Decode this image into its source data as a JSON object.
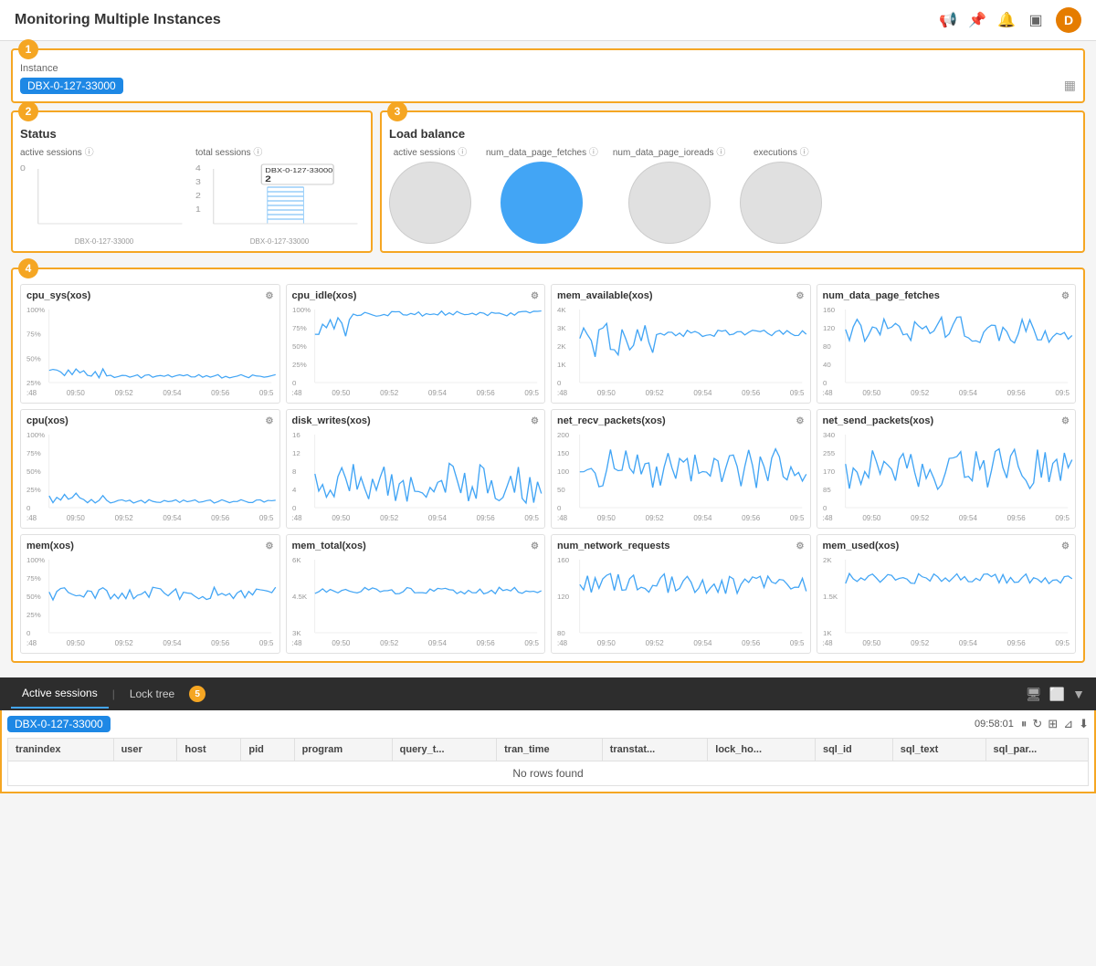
{
  "header": {
    "title": "Monitoring Multiple Instances",
    "avatar": "D"
  },
  "section1": {
    "badge": "1",
    "label": "Instance",
    "tag": "DBX-0-127-33000"
  },
  "section2": {
    "badge": "2",
    "title": "Status",
    "chart1_label": "active sessions",
    "chart2_label": "total sessions",
    "chart2_tooltip": "DBX-0-127-33000",
    "chart2_value": "2",
    "x_label1": "DBX-0-127-33000",
    "x_label2": "DBX-0-127-33000",
    "y_max1": "0",
    "y_max2": "4"
  },
  "section3": {
    "badge": "3",
    "title": "Load balance",
    "bubbles": [
      {
        "label": "active sessions",
        "size": 90,
        "filled": false
      },
      {
        "label": "num_data_page_fetches",
        "size": 90,
        "filled": true
      },
      {
        "label": "num_data_page_ioreads",
        "size": 90,
        "filled": false
      },
      {
        "label": "executions",
        "size": 90,
        "filled": false
      }
    ]
  },
  "section4": {
    "badge": "4",
    "metrics": [
      {
        "id": "cpu_sys",
        "title": "cpu_sys(xos)",
        "y_labels": [
          "100%",
          "75%",
          "50%",
          "25%"
        ],
        "x_labels": [
          ":48",
          "09:50",
          "09:52",
          "09:54",
          "09:56",
          "09:5"
        ]
      },
      {
        "id": "cpu_idle",
        "title": "cpu_idle(xos)",
        "y_labels": [
          "100%",
          "75%",
          "50%",
          "25%",
          "0"
        ],
        "x_labels": [
          ":48",
          "09:50",
          "09:52",
          "09:54",
          "09:56",
          "09:5"
        ]
      },
      {
        "id": "mem_available",
        "title": "mem_available(xos)",
        "y_labels": [
          "4K",
          "3K",
          "2K",
          "1K",
          "0"
        ],
        "x_labels": [
          ":48",
          "09:50",
          "09:52",
          "09:54",
          "09:56",
          "09:5"
        ]
      },
      {
        "id": "num_data_page_fetches",
        "title": "num_data_page_fetches",
        "y_labels": [
          "160",
          "120",
          "80",
          "40",
          "0"
        ],
        "x_labels": [
          ":48",
          "09:50",
          "09:52",
          "09:54",
          "09:56",
          "09:5"
        ]
      },
      {
        "id": "cpu",
        "title": "cpu(xos)",
        "y_labels": [
          "100%",
          "75%",
          "50%",
          "25%",
          "0"
        ],
        "x_labels": [
          ":48",
          "09:50",
          "09:52",
          "09:54",
          "09:56",
          "09:5"
        ]
      },
      {
        "id": "disk_writes",
        "title": "disk_writes(xos)",
        "y_labels": [
          "16",
          "12",
          "8",
          "4",
          "0"
        ],
        "x_labels": [
          ":48",
          "09:50",
          "09:52",
          "09:54",
          "09:56",
          "09:5"
        ]
      },
      {
        "id": "net_recv_packets",
        "title": "net_recv_packets(xos)",
        "y_labels": [
          "200",
          "150",
          "100",
          "50",
          "0"
        ],
        "x_labels": [
          ":48",
          "09:50",
          "09:52",
          "09:54",
          "09:56",
          "09:5"
        ]
      },
      {
        "id": "net_send_packets",
        "title": "net_send_packets(xos)",
        "y_labels": [
          "340",
          "255",
          "170",
          "85",
          "0"
        ],
        "x_labels": [
          ":48",
          "09:50",
          "09:52",
          "09:54",
          "09:56",
          "09:5"
        ]
      },
      {
        "id": "mem",
        "title": "mem(xos)",
        "y_labels": [
          "100%",
          "75%",
          "50%",
          "25%",
          "0"
        ],
        "x_labels": [
          ":48",
          "09:50",
          "09:52",
          "09:54",
          "09:56",
          "09:5"
        ]
      },
      {
        "id": "mem_total",
        "title": "mem_total(xos)",
        "y_labels": [
          "6K",
          "4.5K",
          "3K"
        ],
        "x_labels": [
          ":48",
          "09:50",
          "09:52",
          "09:54",
          "09:56",
          "09:5"
        ]
      },
      {
        "id": "num_network_requests",
        "title": "num_network_requests",
        "y_labels": [
          "160",
          "120",
          "80"
        ],
        "x_labels": [
          ":48",
          "09:50",
          "09:52",
          "09:54",
          "09:56",
          "09:5"
        ]
      },
      {
        "id": "mem_used",
        "title": "mem_used(xos)",
        "y_labels": [
          "2K",
          "1.5K",
          "1K"
        ],
        "x_labels": [
          ":48",
          "09:50",
          "09:52",
          "09:54",
          "09:56",
          "09:5"
        ]
      }
    ]
  },
  "section5": {
    "badge": "5",
    "tabs": [
      {
        "label": "Active sessions",
        "active": true
      },
      {
        "label": "Lock tree",
        "active": false
      }
    ],
    "instance_tag": "DBX-0-127-33000",
    "timestamp": "09:58:01",
    "table": {
      "columns": [
        "tranindex",
        "user",
        "host",
        "pid",
        "program",
        "query_t...",
        "tran_time",
        "transtat...",
        "lock_ho...",
        "sql_id",
        "sql_text",
        "sql_par..."
      ],
      "rows": [],
      "empty_message": "No rows found"
    }
  }
}
